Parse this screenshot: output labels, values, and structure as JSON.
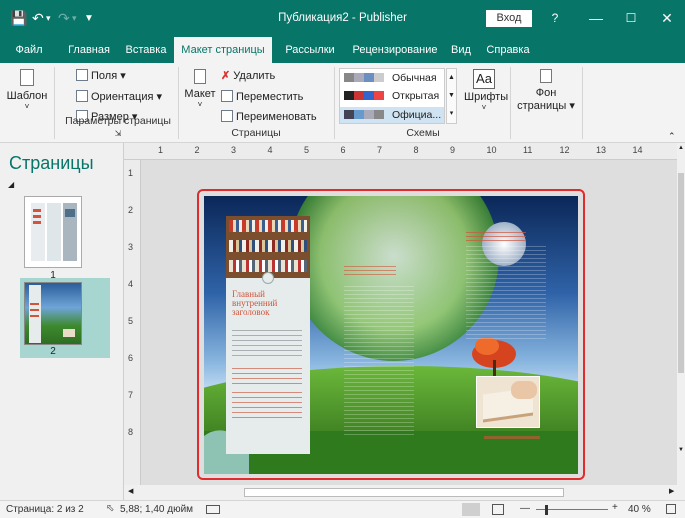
{
  "titlebar": {
    "title": "Публикация2 - Publisher",
    "login": "Вход",
    "help": "?"
  },
  "tabs": [
    "Файл",
    "Главная",
    "Вставка",
    "Макет страницы",
    "Рассылки",
    "Рецензирование",
    "Вид",
    "Справка"
  ],
  "ribbon": {
    "template": "Шаблон",
    "margins": "Поля",
    "orientation": "Ориентация",
    "size": "Размер",
    "group_page_setup": "Параметры страницы",
    "layout": "Макет",
    "delete": "Удалить",
    "move": "Переместить",
    "rename": "Переименовать",
    "group_pages": "Страницы",
    "schemes": [
      "Обычная",
      "Открытая",
      "Официа..."
    ],
    "group_schemes": "Схемы",
    "fonts": "Шрифты",
    "fonts_icon": "Aa",
    "page_bg_line1": "Фон",
    "page_bg_line2": "страницы"
  },
  "pane": {
    "title": "Страницы",
    "pages": [
      "1",
      "2"
    ]
  },
  "ruler": {
    "top": [
      "1",
      "2",
      "3",
      "4",
      "5",
      "6",
      "7",
      "8",
      "9",
      "10",
      "11",
      "12",
      "13",
      "14"
    ],
    "left": [
      "1",
      "2",
      "3",
      "4",
      "5",
      "6",
      "7",
      "8"
    ]
  },
  "page": {
    "heading": "Главный внутренний заголовок"
  },
  "status": {
    "page": "Страница: 2 из 2",
    "position": "5,88; 1,40 дюйм",
    "zoom": "40 %"
  },
  "colors": {
    "accent": "#077568",
    "selection": "#e02c2c",
    "heading": "#d2543a"
  }
}
